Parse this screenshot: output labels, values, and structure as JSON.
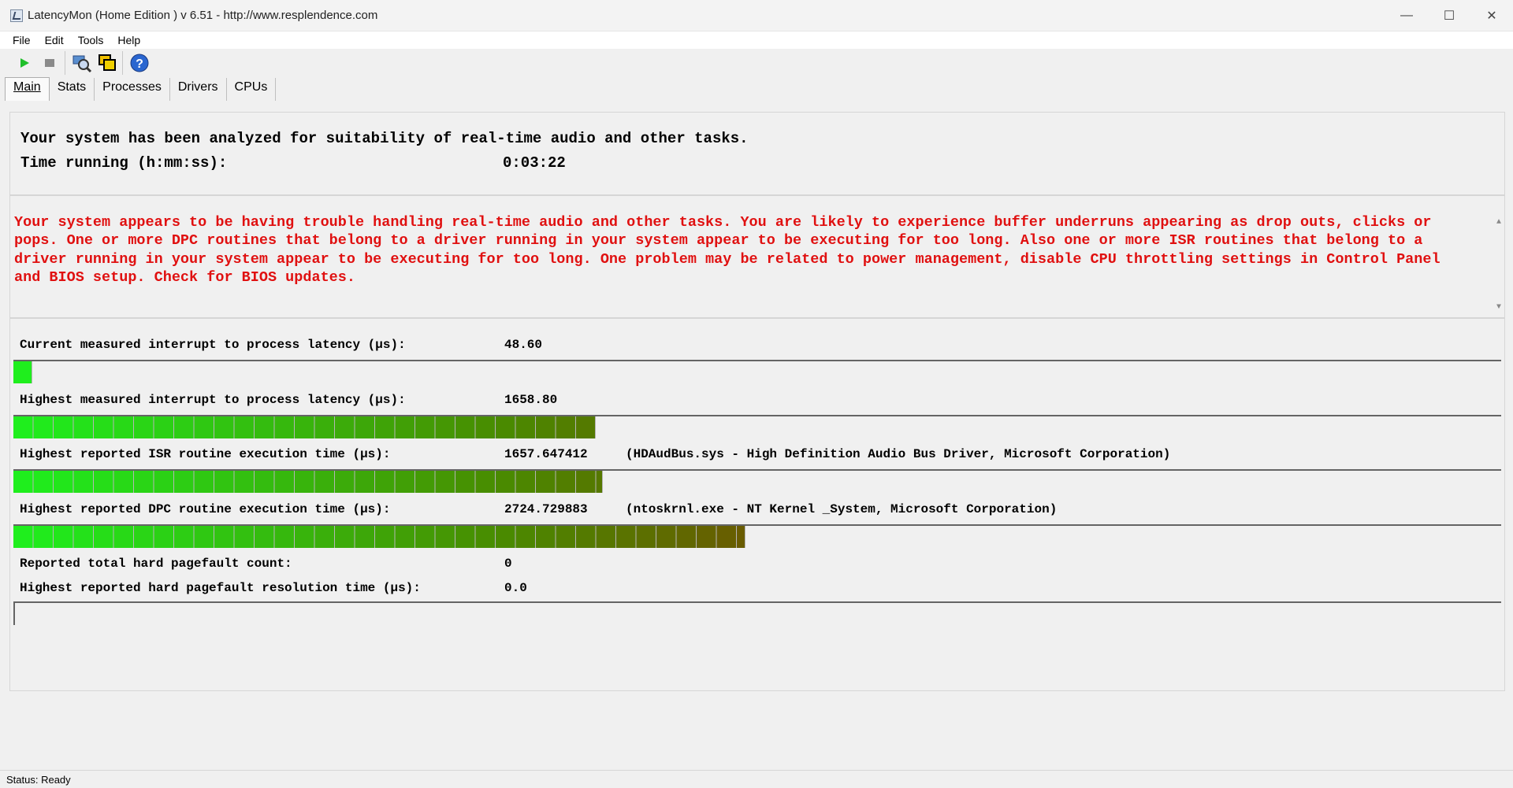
{
  "window": {
    "title": "LatencyMon  (Home Edition )  v 6.51 - http://www.resplendence.com",
    "controls": {
      "minimize": "—",
      "maximize": "☐",
      "close": "✕"
    }
  },
  "menu": {
    "items": [
      {
        "label": "File"
      },
      {
        "label": "Edit"
      },
      {
        "label": "Tools"
      },
      {
        "label": "Help"
      }
    ]
  },
  "toolbar": {
    "icons": [
      "play-icon",
      "stop-icon",
      "search-driver-icon",
      "windows-icon",
      "help-icon"
    ]
  },
  "tabs": [
    {
      "label": "Main",
      "active": true
    },
    {
      "label": "Stats"
    },
    {
      "label": "Processes"
    },
    {
      "label": "Drivers"
    },
    {
      "label": "CPUs"
    }
  ],
  "summary": {
    "line1": "Your system has been analyzed for suitability of real-time audio and other tasks.",
    "time_label": "Time running (h:mm:ss):",
    "time_value": "0:03:22"
  },
  "warning": {
    "text": "Your system appears to be having trouble handling real-time audio and other tasks. You are likely to experience buffer underruns appearing as drop outs, clicks or pops. One or more DPC routines that belong to a driver running in your system appear to be executing for too long. Also one or more ISR routines that belong to a driver running in your system appear to be executing for too long. One problem may be related to power management, disable CPU throttling settings in Control Panel and BIOS setup. Check for BIOS updates.",
    "color": "#e01010"
  },
  "metrics": [
    {
      "label": "Current measured interrupt to process latency (µs):",
      "value": "48.60",
      "desc": "",
      "bar_fraction": 0.0125
    },
    {
      "label": "Highest measured interrupt to process latency (µs):",
      "value": "1658.80",
      "desc": "",
      "bar_fraction": 0.392
    },
    {
      "label": "Highest reported ISR routine execution time (µs):",
      "value": "1657.647412",
      "desc": "(HDAudBus.sys - High Definition Audio Bus Driver, Microsoft Corporation)",
      "bar_fraction": 0.397
    },
    {
      "label": "Highest reported DPC routine execution time (µs):",
      "value": "2724.729883",
      "desc": "(ntoskrnl.exe - NT Kernel _System, Microsoft Corporation)",
      "bar_fraction": 0.493
    },
    {
      "label": "Reported total hard pagefault count:",
      "value": "0",
      "desc": ""
    },
    {
      "label": "Highest reported hard pagefault resolution time (µs):",
      "value": "0.0",
      "desc": "",
      "bar_fraction": 0
    }
  ],
  "colors": {
    "bar_start": "#1ef01e",
    "bar_mid": "#4a8a00",
    "bar_end": "#8a2a00"
  },
  "status": {
    "text": "Status: Ready"
  }
}
